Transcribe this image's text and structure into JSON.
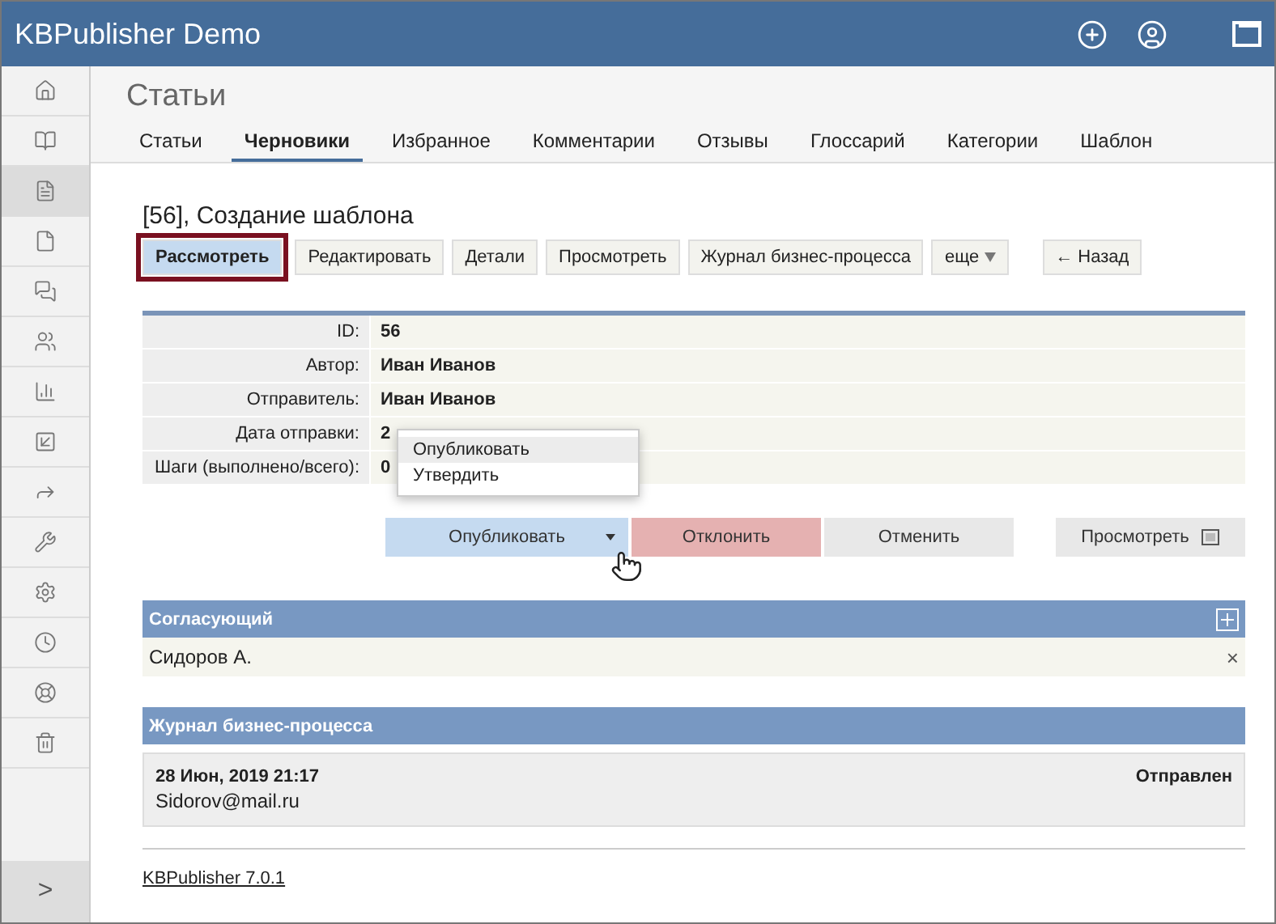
{
  "app": {
    "title": "KBPublisher Demo"
  },
  "sidebar": {
    "items": [
      {
        "kind": "home",
        "selected": false
      },
      {
        "kind": "book",
        "selected": false
      },
      {
        "kind": "document",
        "selected": true
      },
      {
        "kind": "file",
        "selected": false
      },
      {
        "kind": "chat",
        "selected": false
      },
      {
        "kind": "users",
        "selected": false
      },
      {
        "kind": "chart",
        "selected": false
      },
      {
        "kind": "image",
        "selected": false
      },
      {
        "kind": "share",
        "selected": false
      },
      {
        "kind": "wrench",
        "selected": false
      },
      {
        "kind": "gear",
        "selected": false
      },
      {
        "kind": "clock",
        "selected": false
      },
      {
        "kind": "lifebuoy",
        "selected": false
      },
      {
        "kind": "trash",
        "selected": false
      }
    ],
    "expand": ">"
  },
  "page": {
    "title": "Статьи"
  },
  "tabs": [
    {
      "label": "Статьи",
      "selected": false
    },
    {
      "label": "Черновики",
      "selected": true
    },
    {
      "label": "Избранное",
      "selected": false
    },
    {
      "label": "Комментарии",
      "selected": false
    },
    {
      "label": "Отзывы",
      "selected": false
    },
    {
      "label": "Глоссарий",
      "selected": false
    },
    {
      "label": "Категории",
      "selected": false
    },
    {
      "label": "Шаблон",
      "selected": false
    }
  ],
  "record": {
    "title": "[56], Создание шаблона"
  },
  "toolbar": [
    {
      "label": "Рассмотреть",
      "kind": "plain",
      "selected": true
    },
    {
      "label": "Редактировать",
      "kind": "plain",
      "selected": false
    },
    {
      "label": "Детали",
      "kind": "plain",
      "selected": false
    },
    {
      "label": "Просмотреть",
      "kind": "plain",
      "selected": false
    },
    {
      "label": "Журнал бизнес-процесса",
      "kind": "plain",
      "selected": false
    },
    {
      "label": "еще",
      "kind": "menu",
      "selected": false
    },
    {
      "label": "← Назад",
      "kind": "back",
      "selected": false
    }
  ],
  "details": [
    {
      "label": "ID:",
      "value": "56"
    },
    {
      "label": "Автор:",
      "value": "Иван Иванов"
    },
    {
      "label": "Отправитель:",
      "value": "Иван Иванов"
    },
    {
      "label": "Дата отправки:",
      "value": "2"
    },
    {
      "label": "Шаги (выполнено/всего):",
      "value": "0"
    }
  ],
  "dropdown": {
    "items": [
      {
        "label": "Опубликовать",
        "selected": true
      },
      {
        "label": "Утвердить",
        "selected": false
      }
    ]
  },
  "actions": [
    {
      "label": "Опубликовать",
      "kind": "split"
    },
    {
      "label": "Отклонить",
      "kind": "danger"
    },
    {
      "label": "Отменить",
      "kind": "neutral"
    },
    {
      "label": "Просмотреть",
      "kind": "preview"
    }
  ],
  "approvers": {
    "title": "Согласующий",
    "items": [
      {
        "name": "Сидоров А.",
        "remove": "×"
      }
    ]
  },
  "log": {
    "title": "Журнал бизнес-процесса",
    "entries": [
      {
        "date": "28 Июн, 2019 21:17",
        "user": "Sidorov@mail.ru",
        "status": "Отправлен"
      }
    ]
  },
  "footer": {
    "link": "KBPublisher 7.0.1"
  }
}
